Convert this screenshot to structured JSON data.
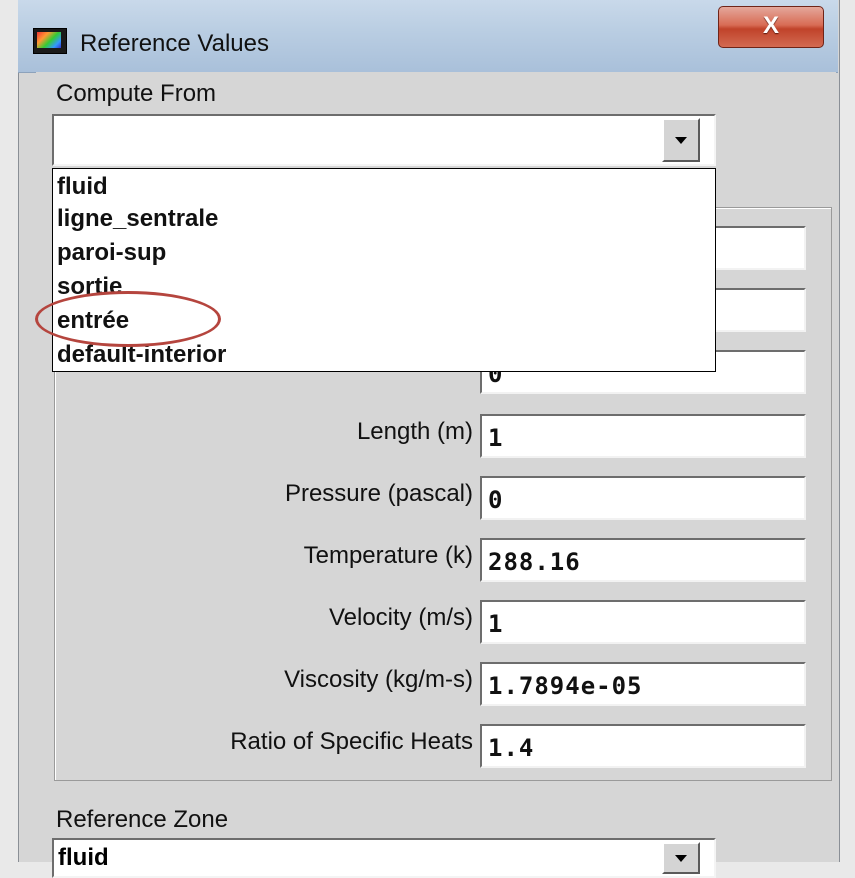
{
  "window": {
    "title": "Reference Values",
    "close_glyph": "X"
  },
  "compute_from": {
    "label": "Compute From",
    "value": "",
    "options": [
      "fluid",
      "ligne_sentrale",
      "paroi-sup",
      "sortie",
      "entrée",
      "default-interior"
    ],
    "highlighted_option": "entrée",
    "annotation_color": "#b5453e"
  },
  "reference_fields": [
    {
      "label": "Length (m)",
      "value": "1"
    },
    {
      "label": "Pressure (pascal)",
      "value": "0"
    },
    {
      "label": "Temperature (k)",
      "value": "288.16"
    },
    {
      "label": "Velocity (m/s)",
      "value": "1"
    },
    {
      "label": "Viscosity (kg/m-s)",
      "value": "1.7894e-05"
    },
    {
      "label": "Ratio of Specific Heats",
      "value": "1.4"
    }
  ],
  "partially_hidden_field_value": "0",
  "reference_zone": {
    "label": "Reference Zone",
    "value": "fluid"
  },
  "icons": {
    "app": "fluent-app-icon",
    "close": "close-icon",
    "dropdown": "chevron-down-icon"
  }
}
